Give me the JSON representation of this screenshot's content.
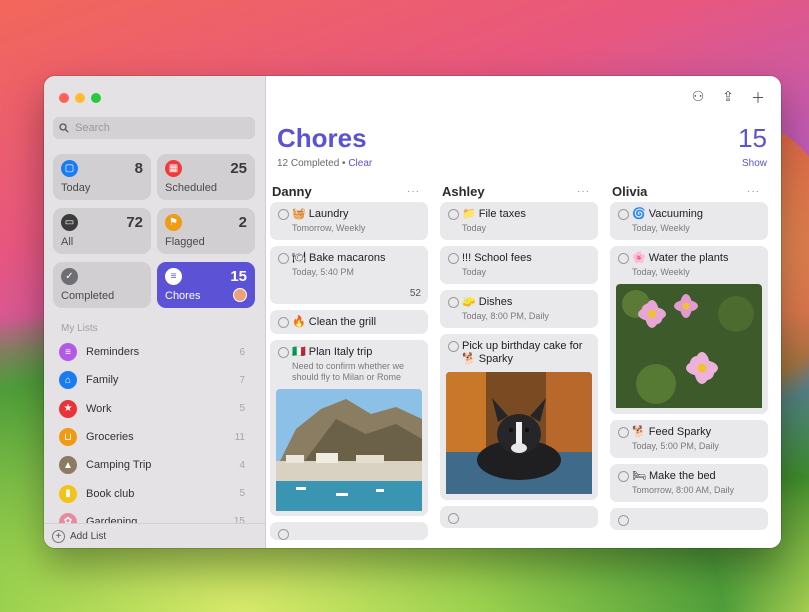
{
  "search": {
    "placeholder": "Search"
  },
  "smart_lists": [
    {
      "label": "Today",
      "count": "8",
      "color": "#1a7cf0"
    },
    {
      "label": "Scheduled",
      "count": "25",
      "color": "#ef3b3b"
    },
    {
      "label": "All",
      "count": "72",
      "color": "#3b3b3b"
    },
    {
      "label": "Flagged",
      "count": "2",
      "color": "#f19a13"
    },
    {
      "label": "Completed",
      "count": "",
      "color": "#6f6f73"
    },
    {
      "label": "Chores",
      "count": "15",
      "color": "#5b52d6"
    }
  ],
  "my_lists_header": "My Lists",
  "lists": [
    {
      "name": "Reminders",
      "count": "6",
      "color": "#b25ae3",
      "icon": "list-icon"
    },
    {
      "name": "Family",
      "count": "7",
      "color": "#1a7cf0",
      "icon": "house-icon"
    },
    {
      "name": "Work",
      "count": "5",
      "color": "#e8333a",
      "icon": "star-icon"
    },
    {
      "name": "Groceries",
      "count": "11",
      "color": "#f19a13",
      "icon": "cart-icon"
    },
    {
      "name": "Camping Trip",
      "count": "4",
      "color": "#8c7a62",
      "icon": "tent-icon"
    },
    {
      "name": "Book club",
      "count": "5",
      "color": "#f5c21a",
      "icon": "bookmark-icon"
    },
    {
      "name": "Gardening",
      "count": "15",
      "color": "#e88a9e",
      "icon": "flower-icon"
    }
  ],
  "add_list": "Add List",
  "main": {
    "title": "Chores",
    "total": "15",
    "completed": "12 Completed",
    "clear": "Clear",
    "show": "Show"
  },
  "columns": [
    {
      "name": "Danny",
      "items": [
        {
          "title": "🧺 Laundry",
          "sub": "Tomorrow, Weekly"
        },
        {
          "title": "🍽 Bake macarons",
          "sub": "Today, 5:40 PM",
          "badge": "52"
        },
        {
          "title": "🔥 Clean the grill",
          "sub": ""
        },
        {
          "title": "🇮🇹 Plan Italy trip",
          "sub": "Need to confirm whether we should fly to Milan or Rome",
          "image": "coast-photo"
        }
      ]
    },
    {
      "name": "Ashley",
      "items": [
        {
          "title": "📁 File taxes",
          "sub": "Today"
        },
        {
          "title": "!!! School fees",
          "sub": "Today"
        },
        {
          "title": "🧽 Dishes",
          "sub": "Today, 8:00 PM, Daily"
        },
        {
          "title": "Pick up birthday cake for 🐕 Sparky",
          "sub": "",
          "image": "dog-photo"
        }
      ]
    },
    {
      "name": "Olivia",
      "items": [
        {
          "title": "🌀 Vacuuming",
          "sub": "Today, Weekly"
        },
        {
          "title": "🌸 Water the plants",
          "sub": "Today, Weekly",
          "image": "flowers-photo"
        },
        {
          "title": "🐕 Feed Sparky",
          "sub": "Today, 5:00 PM, Daily"
        },
        {
          "title": "🛏 Make the bed",
          "sub": "Tomorrow, 8:00 AM, Daily"
        }
      ]
    }
  ]
}
